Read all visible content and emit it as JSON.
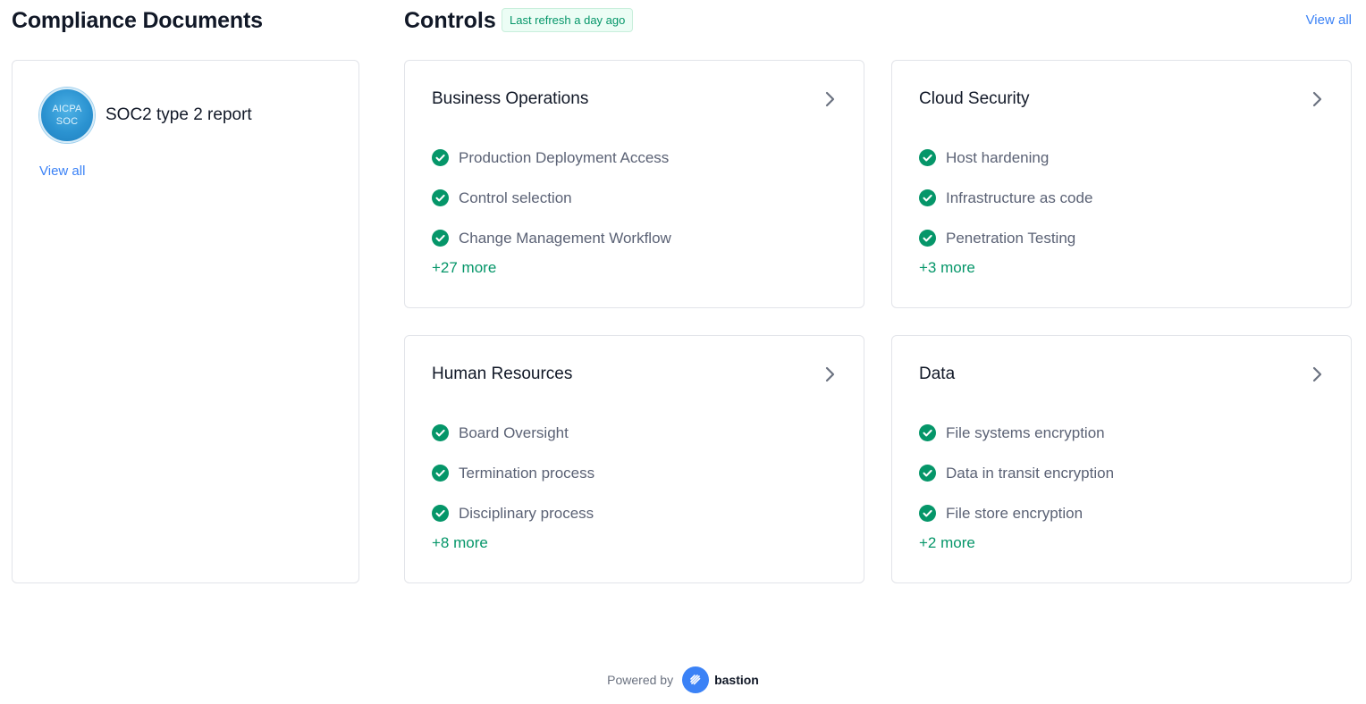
{
  "compliance_documents": {
    "title": "Compliance Documents",
    "items": [
      {
        "name": "SOC2 type 2 report",
        "badge_line1": "AICPA",
        "badge_line2": "SOC"
      }
    ],
    "view_all": "View all"
  },
  "controls": {
    "title": "Controls",
    "refresh_badge": "Last refresh a day ago",
    "view_all": "View all",
    "cards": [
      {
        "title": "Business Operations",
        "items": [
          "Production Deployment Access",
          "Control selection",
          "Change Management Workflow"
        ],
        "more": "+27 more"
      },
      {
        "title": "Cloud Security",
        "items": [
          "Host hardening",
          "Infrastructure as code",
          "Penetration Testing"
        ],
        "more": "+3 more"
      },
      {
        "title": "Human Resources",
        "items": [
          "Board Oversight",
          "Termination process",
          "Disciplinary process"
        ],
        "more": "+8 more"
      },
      {
        "title": "Data",
        "items": [
          "File systems encryption",
          "Data in transit encryption",
          "File store encryption"
        ],
        "more": "+2 more"
      }
    ]
  },
  "footer": {
    "powered_by": "Powered by",
    "brand": "bastion"
  },
  "colors": {
    "accent_blue": "#3b82f6",
    "success_green": "#059669",
    "badge_bg": "#ecfdf5"
  },
  "icons": {
    "status": "check-circle-icon",
    "card_link": "chevron-right-icon",
    "brand": "bastion-logo-icon"
  }
}
